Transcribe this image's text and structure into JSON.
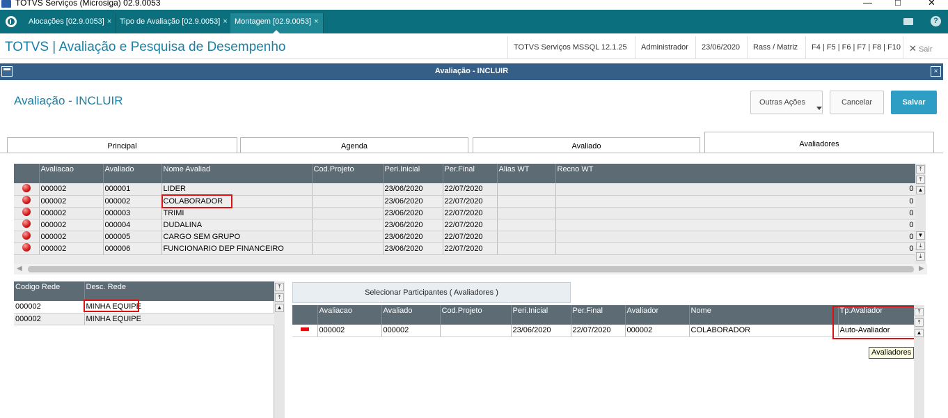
{
  "window": {
    "title": "TOTVS Serviços (Microsiga) 02.9.0053",
    "minimize": "—",
    "maximize": "□",
    "close": "✕"
  },
  "tabs": [
    {
      "label": "Alocações [02.9.0053]",
      "close": "×"
    },
    {
      "label": "Tipo de Avaliação [02.9.0053]",
      "close": "×"
    },
    {
      "label": "Montagem [02.9.0053]",
      "close": "×"
    }
  ],
  "header": {
    "title": "TOTVS | Avaliação e Pesquisa de Desempenho",
    "server": "TOTVS Serviços MSSQL 12.1.25",
    "user": "Administrador",
    "date": "23/06/2020",
    "branch": "Rass / Matriz",
    "shortcuts": "F4 | F5 | F6 | F7 | F8 | F10",
    "exit_icon": "✕",
    "exit_label": "Sair"
  },
  "dialog": {
    "title": "Avaliação - INCLUIR",
    "close": "×"
  },
  "page": {
    "title": "Avaliação - INCLUIR"
  },
  "buttons": {
    "more": "Outras Ações",
    "cancel": "Cancelar",
    "save": "Salvar"
  },
  "folders": [
    {
      "label": "Principal"
    },
    {
      "label": "Agenda"
    },
    {
      "label": "Avaliado"
    },
    {
      "label": "Avaliadores"
    }
  ],
  "evaluation_grid": {
    "columns": [
      "Avaliacao",
      "Avaliado",
      "Nome Avaliad",
      "Cod.Projeto",
      "Peri.Inicial",
      "Per.Final",
      "Alias WT",
      "Recno WT"
    ],
    "rows": [
      {
        "avaliacao": "000002",
        "avaliado": "000001",
        "nome": "LIDER",
        "projeto": "",
        "inicio": "23/06/2020",
        "fim": "22/07/2020",
        "alias": "",
        "recno": "0"
      },
      {
        "avaliacao": "000002",
        "avaliado": "000002",
        "nome": "COLABORADOR",
        "projeto": "",
        "inicio": "23/06/2020",
        "fim": "22/07/2020",
        "alias": "",
        "recno": "0"
      },
      {
        "avaliacao": "000002",
        "avaliado": "000003",
        "nome": "TRIMI",
        "projeto": "",
        "inicio": "23/06/2020",
        "fim": "22/07/2020",
        "alias": "",
        "recno": "0"
      },
      {
        "avaliacao": "000002",
        "avaliado": "000004",
        "nome": "DUDALINA",
        "projeto": "",
        "inicio": "23/06/2020",
        "fim": "22/07/2020",
        "alias": "",
        "recno": "0"
      },
      {
        "avaliacao": "000002",
        "avaliado": "000005",
        "nome": "CARGO SEM GRUPO",
        "projeto": "",
        "inicio": "23/06/2020",
        "fim": "22/07/2020",
        "alias": "",
        "recno": "0"
      },
      {
        "avaliacao": "000002",
        "avaliado": "000006",
        "nome": "FUNCIONARIO DEP FINANCEIRO",
        "projeto": "",
        "inicio": "23/06/2020",
        "fim": "22/07/2020",
        "alias": "",
        "recno": "0"
      }
    ]
  },
  "network_grid": {
    "columns": [
      "Codigo Rede",
      "Desc. Rede"
    ],
    "rows": [
      {
        "codigo": "000002",
        "desc": "MINHA EQUIPE"
      },
      {
        "codigo": "000002",
        "desc": "MINHA EQUIPE"
      }
    ]
  },
  "select_button": {
    "label": "Selecionar Participantes ( Avaliadores )"
  },
  "evaluators_grid": {
    "columns": [
      "Avaliacao",
      "Avaliado",
      "Cod.Projeto",
      "Peri.Inicial",
      "Per.Final",
      "Avaliador",
      "Nome",
      "Tp.Avaliador"
    ],
    "rows": [
      {
        "avaliacao": "000002",
        "avaliado": "000002",
        "projeto": "",
        "inicio": "23/06/2020",
        "fim": "22/07/2020",
        "avaliador": "000002",
        "nome": "COLABORADOR",
        "tipo": "Auto-Avaliador"
      }
    ]
  },
  "tooltip": {
    "text": "Avaliadores"
  },
  "scroll": {
    "top": "⤒",
    "up": "▲",
    "down": "▼",
    "bottom": "⤓",
    "left": "◀",
    "right": "▶"
  }
}
